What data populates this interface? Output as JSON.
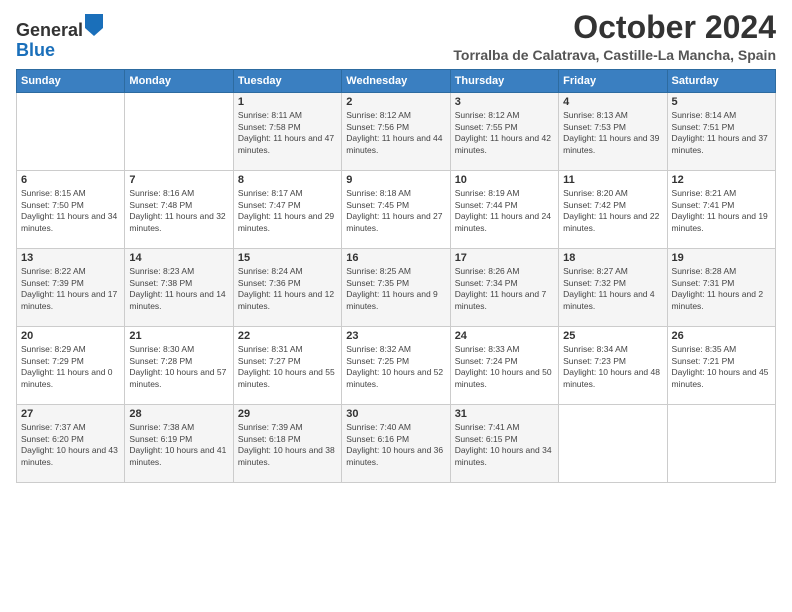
{
  "logo": {
    "general": "General",
    "blue": "Blue"
  },
  "title": "October 2024",
  "location": "Torralba de Calatrava, Castille-La Mancha, Spain",
  "days_of_week": [
    "Sunday",
    "Monday",
    "Tuesday",
    "Wednesday",
    "Thursday",
    "Friday",
    "Saturday"
  ],
  "weeks": [
    [
      {
        "day": "",
        "sunrise": "",
        "sunset": "",
        "daylight": ""
      },
      {
        "day": "",
        "sunrise": "",
        "sunset": "",
        "daylight": ""
      },
      {
        "day": "1",
        "sunrise": "Sunrise: 8:11 AM",
        "sunset": "Sunset: 7:58 PM",
        "daylight": "Daylight: 11 hours and 47 minutes."
      },
      {
        "day": "2",
        "sunrise": "Sunrise: 8:12 AM",
        "sunset": "Sunset: 7:56 PM",
        "daylight": "Daylight: 11 hours and 44 minutes."
      },
      {
        "day": "3",
        "sunrise": "Sunrise: 8:12 AM",
        "sunset": "Sunset: 7:55 PM",
        "daylight": "Daylight: 11 hours and 42 minutes."
      },
      {
        "day": "4",
        "sunrise": "Sunrise: 8:13 AM",
        "sunset": "Sunset: 7:53 PM",
        "daylight": "Daylight: 11 hours and 39 minutes."
      },
      {
        "day": "5",
        "sunrise": "Sunrise: 8:14 AM",
        "sunset": "Sunset: 7:51 PM",
        "daylight": "Daylight: 11 hours and 37 minutes."
      }
    ],
    [
      {
        "day": "6",
        "sunrise": "Sunrise: 8:15 AM",
        "sunset": "Sunset: 7:50 PM",
        "daylight": "Daylight: 11 hours and 34 minutes."
      },
      {
        "day": "7",
        "sunrise": "Sunrise: 8:16 AM",
        "sunset": "Sunset: 7:48 PM",
        "daylight": "Daylight: 11 hours and 32 minutes."
      },
      {
        "day": "8",
        "sunrise": "Sunrise: 8:17 AM",
        "sunset": "Sunset: 7:47 PM",
        "daylight": "Daylight: 11 hours and 29 minutes."
      },
      {
        "day": "9",
        "sunrise": "Sunrise: 8:18 AM",
        "sunset": "Sunset: 7:45 PM",
        "daylight": "Daylight: 11 hours and 27 minutes."
      },
      {
        "day": "10",
        "sunrise": "Sunrise: 8:19 AM",
        "sunset": "Sunset: 7:44 PM",
        "daylight": "Daylight: 11 hours and 24 minutes."
      },
      {
        "day": "11",
        "sunrise": "Sunrise: 8:20 AM",
        "sunset": "Sunset: 7:42 PM",
        "daylight": "Daylight: 11 hours and 22 minutes."
      },
      {
        "day": "12",
        "sunrise": "Sunrise: 8:21 AM",
        "sunset": "Sunset: 7:41 PM",
        "daylight": "Daylight: 11 hours and 19 minutes."
      }
    ],
    [
      {
        "day": "13",
        "sunrise": "Sunrise: 8:22 AM",
        "sunset": "Sunset: 7:39 PM",
        "daylight": "Daylight: 11 hours and 17 minutes."
      },
      {
        "day": "14",
        "sunrise": "Sunrise: 8:23 AM",
        "sunset": "Sunset: 7:38 PM",
        "daylight": "Daylight: 11 hours and 14 minutes."
      },
      {
        "day": "15",
        "sunrise": "Sunrise: 8:24 AM",
        "sunset": "Sunset: 7:36 PM",
        "daylight": "Daylight: 11 hours and 12 minutes."
      },
      {
        "day": "16",
        "sunrise": "Sunrise: 8:25 AM",
        "sunset": "Sunset: 7:35 PM",
        "daylight": "Daylight: 11 hours and 9 minutes."
      },
      {
        "day": "17",
        "sunrise": "Sunrise: 8:26 AM",
        "sunset": "Sunset: 7:34 PM",
        "daylight": "Daylight: 11 hours and 7 minutes."
      },
      {
        "day": "18",
        "sunrise": "Sunrise: 8:27 AM",
        "sunset": "Sunset: 7:32 PM",
        "daylight": "Daylight: 11 hours and 4 minutes."
      },
      {
        "day": "19",
        "sunrise": "Sunrise: 8:28 AM",
        "sunset": "Sunset: 7:31 PM",
        "daylight": "Daylight: 11 hours and 2 minutes."
      }
    ],
    [
      {
        "day": "20",
        "sunrise": "Sunrise: 8:29 AM",
        "sunset": "Sunset: 7:29 PM",
        "daylight": "Daylight: 11 hours and 0 minutes."
      },
      {
        "day": "21",
        "sunrise": "Sunrise: 8:30 AM",
        "sunset": "Sunset: 7:28 PM",
        "daylight": "Daylight: 10 hours and 57 minutes."
      },
      {
        "day": "22",
        "sunrise": "Sunrise: 8:31 AM",
        "sunset": "Sunset: 7:27 PM",
        "daylight": "Daylight: 10 hours and 55 minutes."
      },
      {
        "day": "23",
        "sunrise": "Sunrise: 8:32 AM",
        "sunset": "Sunset: 7:25 PM",
        "daylight": "Daylight: 10 hours and 52 minutes."
      },
      {
        "day": "24",
        "sunrise": "Sunrise: 8:33 AM",
        "sunset": "Sunset: 7:24 PM",
        "daylight": "Daylight: 10 hours and 50 minutes."
      },
      {
        "day": "25",
        "sunrise": "Sunrise: 8:34 AM",
        "sunset": "Sunset: 7:23 PM",
        "daylight": "Daylight: 10 hours and 48 minutes."
      },
      {
        "day": "26",
        "sunrise": "Sunrise: 8:35 AM",
        "sunset": "Sunset: 7:21 PM",
        "daylight": "Daylight: 10 hours and 45 minutes."
      }
    ],
    [
      {
        "day": "27",
        "sunrise": "Sunrise: 7:37 AM",
        "sunset": "Sunset: 6:20 PM",
        "daylight": "Daylight: 10 hours and 43 minutes."
      },
      {
        "day": "28",
        "sunrise": "Sunrise: 7:38 AM",
        "sunset": "Sunset: 6:19 PM",
        "daylight": "Daylight: 10 hours and 41 minutes."
      },
      {
        "day": "29",
        "sunrise": "Sunrise: 7:39 AM",
        "sunset": "Sunset: 6:18 PM",
        "daylight": "Daylight: 10 hours and 38 minutes."
      },
      {
        "day": "30",
        "sunrise": "Sunrise: 7:40 AM",
        "sunset": "Sunset: 6:16 PM",
        "daylight": "Daylight: 10 hours and 36 minutes."
      },
      {
        "day": "31",
        "sunrise": "Sunrise: 7:41 AM",
        "sunset": "Sunset: 6:15 PM",
        "daylight": "Daylight: 10 hours and 34 minutes."
      },
      {
        "day": "",
        "sunrise": "",
        "sunset": "",
        "daylight": ""
      },
      {
        "day": "",
        "sunrise": "",
        "sunset": "",
        "daylight": ""
      }
    ]
  ]
}
